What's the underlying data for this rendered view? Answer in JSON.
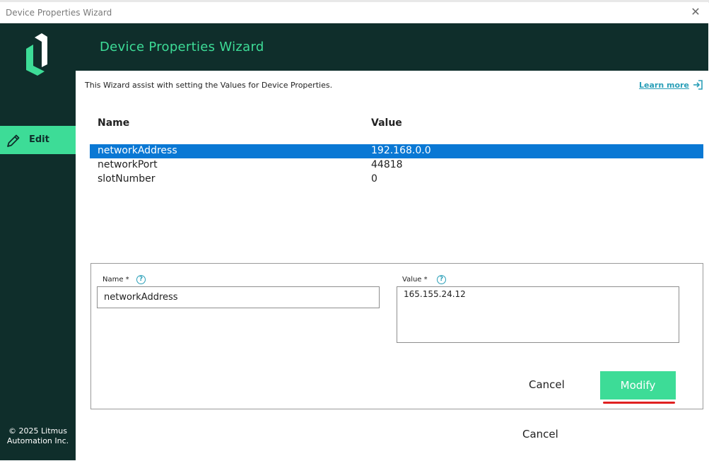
{
  "window": {
    "title": "Device Properties Wizard",
    "close_glyph": "✕"
  },
  "sidebar": {
    "edit_label": "Edit",
    "copyright_line1": "© 2025 Litmus",
    "copyright_line2": "Automation Inc."
  },
  "header": {
    "title": "Device Properties Wizard"
  },
  "content": {
    "intro": "This Wizard assist with setting the Values for Device Properties.",
    "learn_more": "Learn more"
  },
  "table": {
    "columns": [
      "Name",
      "Value"
    ],
    "rows": [
      {
        "name": "networkAddress",
        "value": "192.168.0.0",
        "selected": true
      },
      {
        "name": "networkPort",
        "value": "44818",
        "selected": false
      },
      {
        "name": "slotNumber",
        "value": "0",
        "selected": false
      }
    ]
  },
  "form": {
    "name_label": "Name *",
    "name_value": "networkAddress",
    "value_label": "Value *",
    "value_value": "165.155.24.12",
    "help_glyph": "?",
    "cancel_label": "Cancel",
    "modify_label": "Modify"
  },
  "footer": {
    "cancel_label": "Cancel"
  },
  "colors": {
    "sidebar_bg": "#0f2e2b",
    "accent": "#3ddc97",
    "selection": "#0a78d4",
    "link": "#2a9fb8",
    "highlight_mark": "#e02020"
  },
  "icons": {
    "logo": "litmus-logo",
    "edit": "pencil-icon",
    "learn_more": "exit-arrow-icon",
    "help": "question-circle-icon",
    "close": "close-icon"
  }
}
